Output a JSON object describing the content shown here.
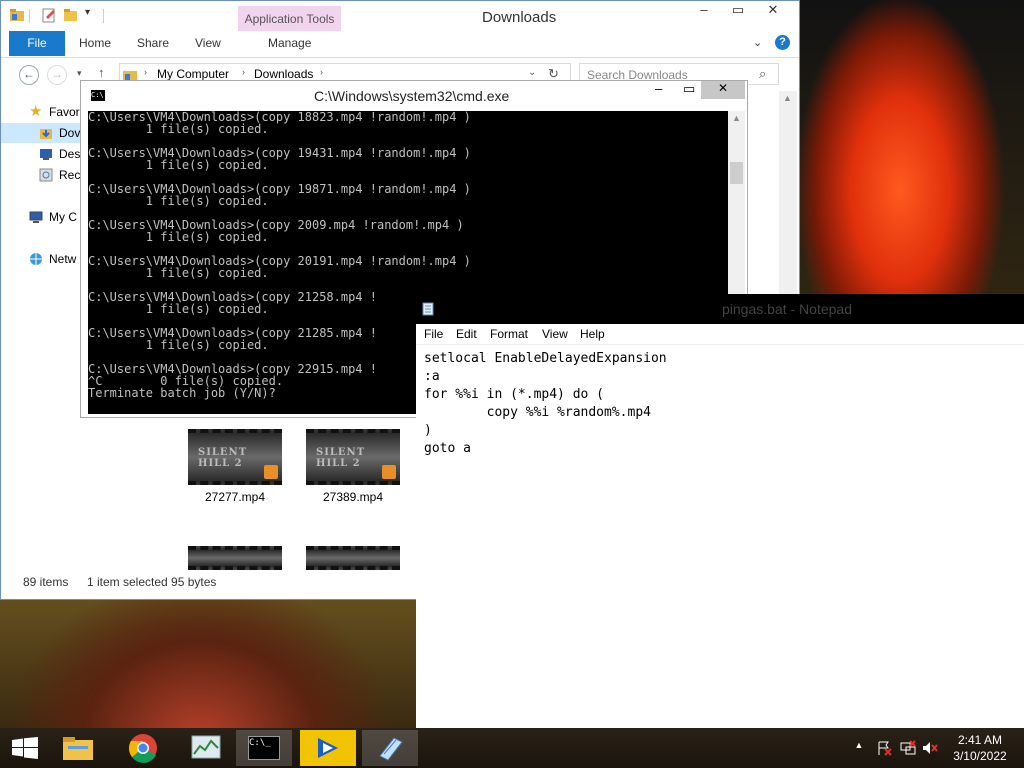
{
  "explorer": {
    "title": "Downloads",
    "context_tab": "Application Tools",
    "ribbon_tabs": [
      "File",
      "Home",
      "Share",
      "View",
      "Manage"
    ],
    "breadcrumb": [
      "My Computer",
      "Downloads"
    ],
    "search_placeholder": "Search Downloads",
    "nav": {
      "favorites": "Favor",
      "downloads": "Dov",
      "desktop": "Des",
      "recent": "Rec",
      "computer": "My C",
      "network": "Netw"
    },
    "files": [
      {
        "name": "27277.mp4"
      },
      {
        "name": "27389.mp4"
      }
    ],
    "status": {
      "count": "89 items",
      "selected": "1 item selected  95 bytes"
    }
  },
  "cmd": {
    "title": "C:\\Windows\\system32\\cmd.exe",
    "lines": [
      "C:\\Users\\VM4\\Downloads>(copy 18823.mp4 !random!.mp4 )",
      "        1 file(s) copied.",
      "",
      "C:\\Users\\VM4\\Downloads>(copy 19431.mp4 !random!.mp4 )",
      "        1 file(s) copied.",
      "",
      "C:\\Users\\VM4\\Downloads>(copy 19871.mp4 !random!.mp4 )",
      "        1 file(s) copied.",
      "",
      "C:\\Users\\VM4\\Downloads>(copy 2009.mp4 !random!.mp4 )",
      "        1 file(s) copied.",
      "",
      "C:\\Users\\VM4\\Downloads>(copy 20191.mp4 !random!.mp4 )",
      "        1 file(s) copied.",
      "",
      "C:\\Users\\VM4\\Downloads>(copy 21258.mp4 !",
      "        1 file(s) copied.",
      "",
      "C:\\Users\\VM4\\Downloads>(copy 21285.mp4 !",
      "        1 file(s) copied.",
      "",
      "C:\\Users\\VM4\\Downloads>(copy 22915.mp4 !",
      "^C        0 file(s) copied.",
      "Terminate batch job (Y/N)?"
    ]
  },
  "notepad": {
    "title": "pingas.bat - Notepad",
    "menu": [
      "File",
      "Edit",
      "Format",
      "View",
      "Help"
    ],
    "content": "setlocal EnableDelayedExpansion\n:a\nfor %%i in (*.mp4) do (\n        copy %%i %random%.mp4\n)\ngoto a"
  },
  "taskbar": {
    "time": "2:41 AM",
    "date": "3/10/2022"
  },
  "colors": {
    "accent": "#1979ca",
    "context_tab": "#f3d4ef",
    "console_bg": "#000000",
    "console_fg": "#c0c0c0"
  }
}
